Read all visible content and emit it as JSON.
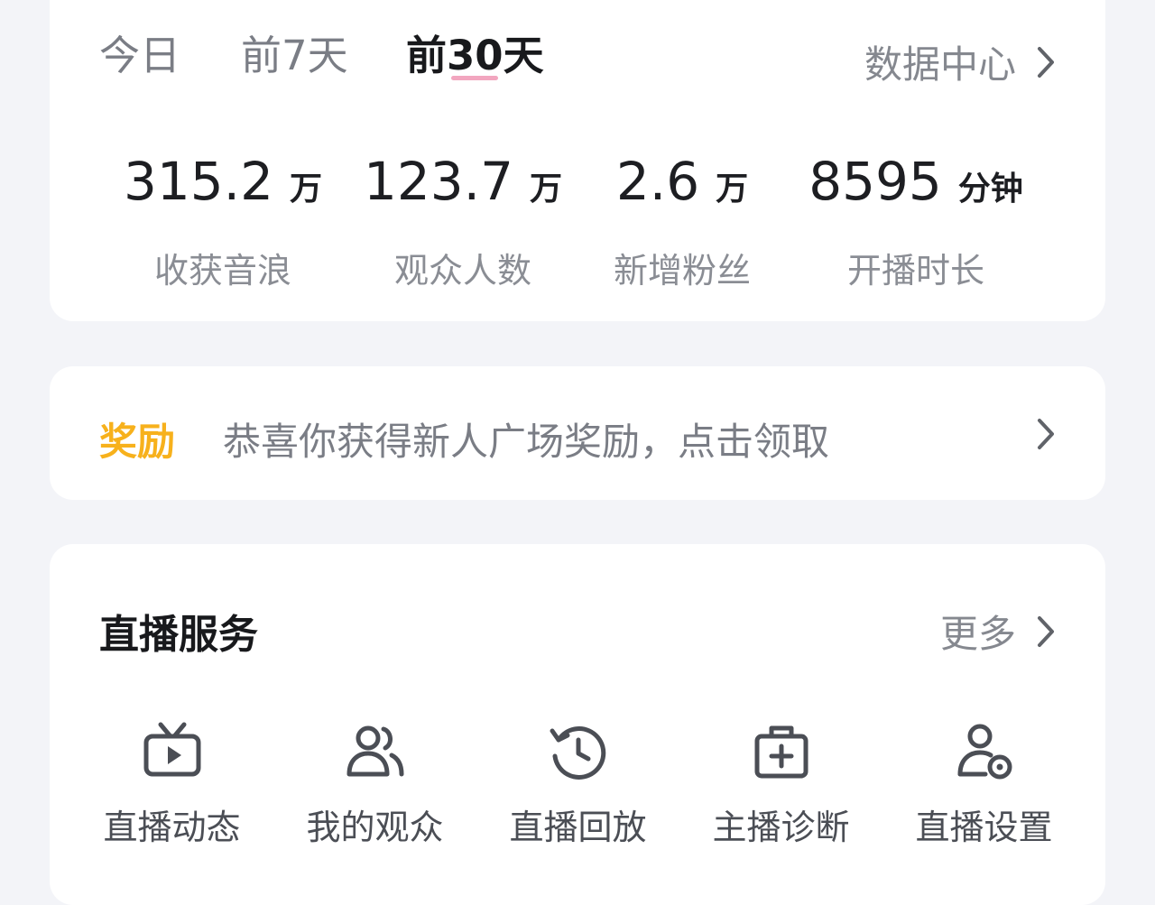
{
  "tabs": [
    {
      "label": "今日",
      "active": false
    },
    {
      "label": "前7天",
      "active": false
    },
    {
      "label": "前30天",
      "active": true
    }
  ],
  "data_center": {
    "label": "数据中心"
  },
  "stats": [
    {
      "value": "315.2",
      "unit": "万",
      "label": "收获音浪"
    },
    {
      "value": "123.7",
      "unit": "万",
      "label": "观众人数"
    },
    {
      "value": "2.6",
      "unit": "万",
      "label": "新增粉丝"
    },
    {
      "value": "8595",
      "unit": "分钟",
      "label": "开播时长"
    }
  ],
  "reward": {
    "tag": "奖励",
    "text": "恭喜你获得新人广场奖励，点击领取"
  },
  "live_service": {
    "title": "直播服务",
    "more_label": "更多",
    "items": [
      {
        "label": "直播动态",
        "icon": "tv-play-icon"
      },
      {
        "label": "我的观众",
        "icon": "users-icon"
      },
      {
        "label": "直播回放",
        "icon": "history-icon"
      },
      {
        "label": "主播诊断",
        "icon": "medical-kit-icon"
      },
      {
        "label": "直播设置",
        "icon": "user-settings-icon"
      }
    ]
  },
  "colors": {
    "accent_underline": "#f2a6bf",
    "reward_tag": "#f7b11c",
    "background": "#f3f4f8"
  }
}
